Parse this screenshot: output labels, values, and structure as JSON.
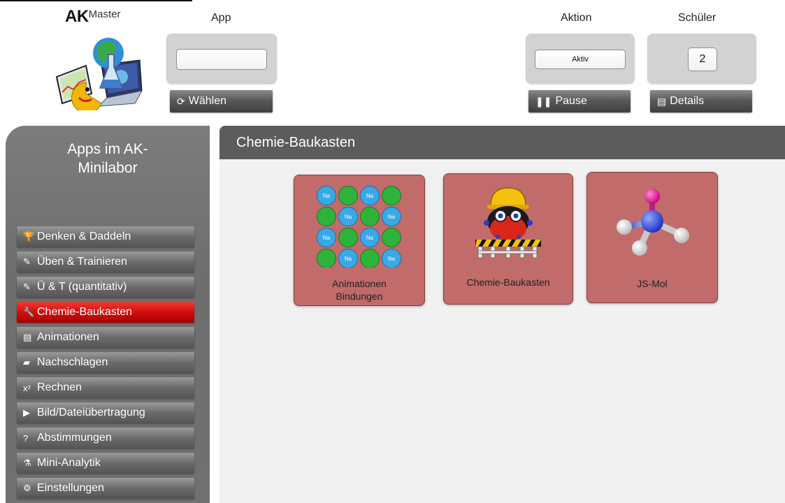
{
  "logo": {
    "bold": "AK",
    "rest": "Master"
  },
  "header": {
    "app": {
      "label": "App",
      "field_value": "",
      "button": "Wählen",
      "button_icon": "refresh-icon"
    },
    "aktion": {
      "label": "Aktion",
      "field_value": "Aktiv",
      "button": "Pause",
      "button_icon": "pause-icon"
    },
    "schueler": {
      "label": "Schüler",
      "count": "2",
      "button": "Details",
      "button_icon": "table-icon"
    }
  },
  "sidebar": {
    "title_line1": "Apps im AK-",
    "title_line2": "Minilabor",
    "items": [
      {
        "label": "Denken & Daddeln",
        "icon": "trophy-icon",
        "glyph": "🏆"
      },
      {
        "label": "Üben & Trainieren",
        "icon": "edit-icon",
        "glyph": "✎"
      },
      {
        "label": "Ü & T (quantitativ)",
        "icon": "edit-icon",
        "glyph": "✎"
      },
      {
        "label": "Chemie-Baukasten",
        "icon": "wrench-icon",
        "glyph": "🔧",
        "active": true
      },
      {
        "label": "Animationen",
        "icon": "film-icon",
        "glyph": "▤"
      },
      {
        "label": "Nachschlagen",
        "icon": "book-icon",
        "glyph": "▰"
      },
      {
        "label": "Rechnen",
        "icon": "superscript-icon",
        "glyph": "x²"
      },
      {
        "label": "Bild/Dateiübertragung",
        "icon": "video-icon",
        "glyph": "▶"
      },
      {
        "label": "Abstimmungen",
        "icon": "question-icon",
        "glyph": "?"
      },
      {
        "label": "Mini-Analytik",
        "icon": "flask-icon",
        "glyph": "⚗"
      },
      {
        "label": "Einstellungen",
        "icon": "gear-icon",
        "glyph": "⚙"
      }
    ]
  },
  "main": {
    "title": "Chemie-Baukasten",
    "tiles": [
      {
        "label_line1": "Animationen",
        "label_line2": "Bindungen",
        "icon": "ion-grid-icon",
        "ion_text": "Na"
      },
      {
        "label_line1": "Chemie-Baukasten",
        "label_line2": "",
        "icon": "construction-worker-icon"
      },
      {
        "label_line1": "JS-Mol",
        "label_line2": "",
        "icon": "molecule-icon"
      }
    ]
  },
  "colors": {
    "active_nav": "#d10e0e",
    "tile_bg": "#c16b6b",
    "header_bar": "#5c5c5c",
    "sidebar_bg": "#747474"
  }
}
